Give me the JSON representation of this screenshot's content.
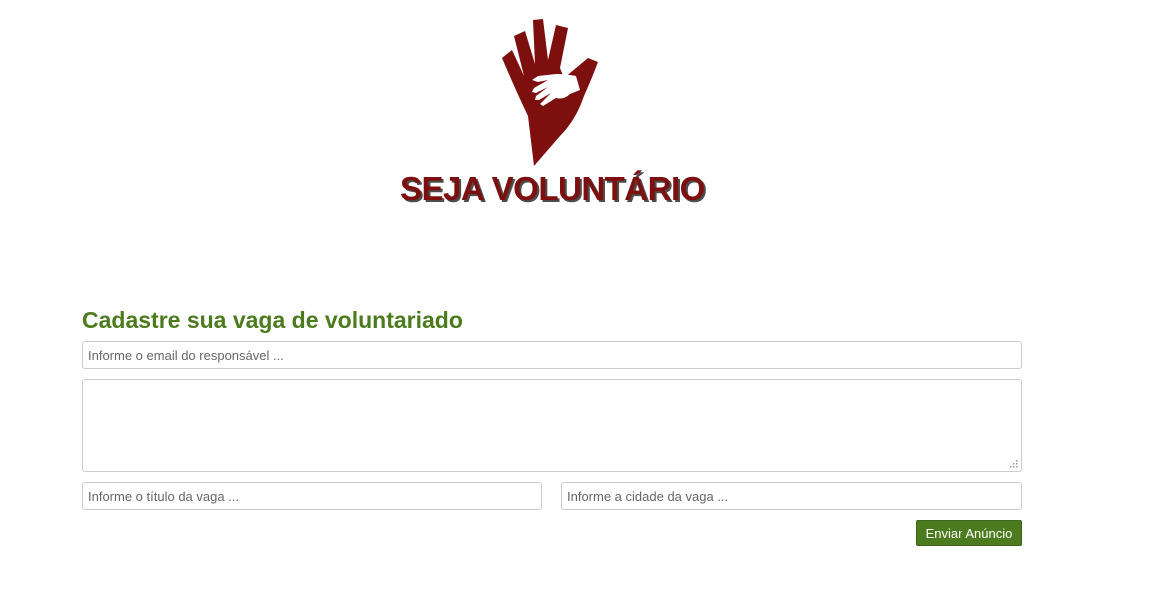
{
  "logo": {
    "text": "SEJA VOLUNTÁRIO",
    "icon": "hand-icon"
  },
  "form": {
    "title": "Cadastre sua vaga de voluntariado",
    "email_placeholder": "Informe o email do responsável ...",
    "description_value": "",
    "title_placeholder": "Informe o título da vaga ...",
    "city_placeholder": "Informe a cidade da vaga ...",
    "submit_label": "Enviar Anúncio"
  },
  "colors": {
    "brand_red": "#7d0f0f",
    "accent_green": "#4c7a1e",
    "border": "#cccccc"
  }
}
